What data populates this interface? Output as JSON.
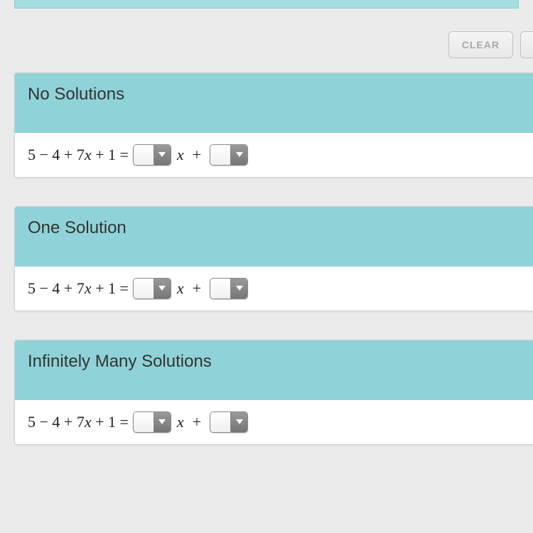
{
  "buttons": {
    "clear": "CLEAR"
  },
  "sections": [
    {
      "title": "No Solutions",
      "equation_left": "5 − 4 + 7",
      "equation_x": "x",
      "equation_after": " + 1 = ",
      "mid_text": "x",
      "plus": " + "
    },
    {
      "title": "One Solution",
      "equation_left": "5 − 4 + 7",
      "equation_x": "x",
      "equation_after": " + 1 = ",
      "mid_text": "x",
      "plus": " + "
    },
    {
      "title": "Infinitely Many Solutions",
      "equation_left": "5 − 4 + 7",
      "equation_x": "x",
      "equation_after": " + 1 = ",
      "mid_text": "x",
      "plus": " + "
    }
  ]
}
